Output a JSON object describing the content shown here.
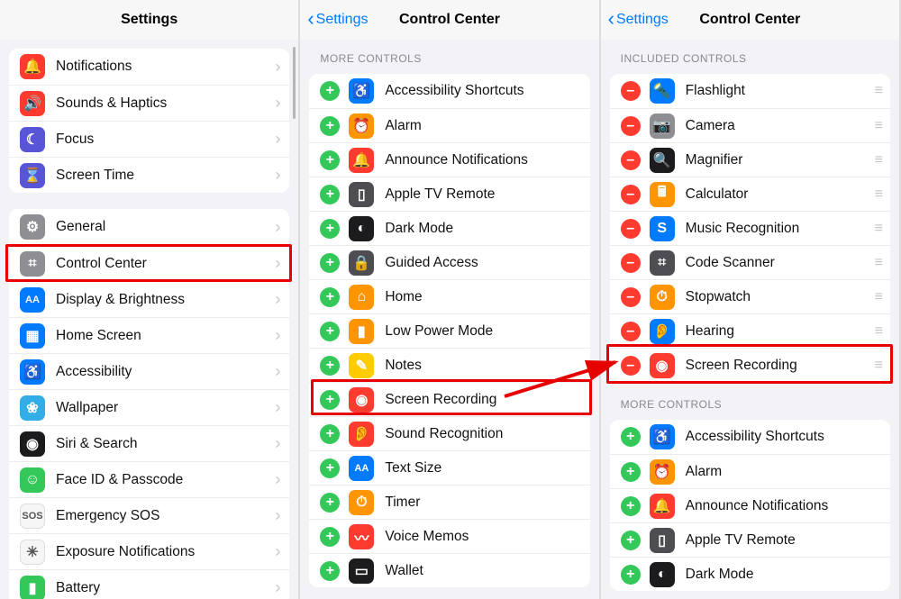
{
  "pane1": {
    "title": "Settings",
    "groupA": [
      {
        "label": "Notifications",
        "icon": "bell",
        "color": "c-red"
      },
      {
        "label": "Sounds & Haptics",
        "icon": "speaker",
        "color": "c-red"
      },
      {
        "label": "Focus",
        "icon": "moon",
        "color": "c-purple"
      },
      {
        "label": "Screen Time",
        "icon": "hourglass",
        "color": "c-purple"
      }
    ],
    "groupB": [
      {
        "label": "General",
        "icon": "gear",
        "color": "c-gray"
      },
      {
        "label": "Control Center",
        "icon": "toggles",
        "color": "c-gray"
      },
      {
        "label": "Display & Brightness",
        "icon": "AA",
        "color": "c-blue"
      },
      {
        "label": "Home Screen",
        "icon": "grid",
        "color": "c-blue"
      },
      {
        "label": "Accessibility",
        "icon": "person",
        "color": "c-blue"
      },
      {
        "label": "Wallpaper",
        "icon": "flower",
        "color": "c-cyan"
      },
      {
        "label": "Siri & Search",
        "icon": "siri",
        "color": "c-black"
      },
      {
        "label": "Face ID & Passcode",
        "icon": "face",
        "color": "c-green"
      },
      {
        "label": "Emergency SOS",
        "icon": "SOS",
        "color": "c-white"
      },
      {
        "label": "Exposure Notifications",
        "icon": "exposure",
        "color": "c-white"
      },
      {
        "label": "Battery",
        "icon": "battery",
        "color": "c-green"
      }
    ]
  },
  "pane2": {
    "back": "Settings",
    "title": "Control Center",
    "header": "More Controls",
    "items": [
      {
        "label": "Accessibility Shortcuts",
        "color": "c-blue",
        "icon": "access"
      },
      {
        "label": "Alarm",
        "color": "c-orange",
        "icon": "clock"
      },
      {
        "label": "Announce Notifications",
        "color": "c-red",
        "icon": "bell"
      },
      {
        "label": "Apple TV Remote",
        "color": "c-darkgray",
        "icon": "remote"
      },
      {
        "label": "Dark Mode",
        "color": "c-black",
        "icon": "dark"
      },
      {
        "label": "Guided Access",
        "color": "c-darkgray",
        "icon": "lock"
      },
      {
        "label": "Home",
        "color": "c-orange",
        "icon": "home"
      },
      {
        "label": "Low Power Mode",
        "color": "c-orange",
        "icon": "battery"
      },
      {
        "label": "Notes",
        "color": "c-yellow",
        "icon": "notes"
      },
      {
        "label": "Screen Recording",
        "color": "c-red",
        "icon": "record"
      },
      {
        "label": "Sound Recognition",
        "color": "c-red",
        "icon": "ear"
      },
      {
        "label": "Text Size",
        "color": "c-blue",
        "icon": "AA"
      },
      {
        "label": "Timer",
        "color": "c-orange",
        "icon": "timer"
      },
      {
        "label": "Voice Memos",
        "color": "c-red",
        "icon": "wave"
      },
      {
        "label": "Wallet",
        "color": "c-black",
        "icon": "wallet"
      }
    ]
  },
  "pane3": {
    "back": "Settings",
    "title": "Control Center",
    "header_included": "Included Controls",
    "included": [
      {
        "label": "Flashlight",
        "color": "c-blue",
        "icon": "torch"
      },
      {
        "label": "Camera",
        "color": "c-gray",
        "icon": "camera"
      },
      {
        "label": "Magnifier",
        "color": "c-black",
        "icon": "magnify"
      },
      {
        "label": "Calculator",
        "color": "c-orange",
        "icon": "calc"
      },
      {
        "label": "Music Recognition",
        "color": "c-blue",
        "icon": "shazam"
      },
      {
        "label": "Code Scanner",
        "color": "c-darkgray",
        "icon": "scan"
      },
      {
        "label": "Stopwatch",
        "color": "c-orange",
        "icon": "stop"
      },
      {
        "label": "Hearing",
        "color": "c-blue",
        "icon": "hearing"
      },
      {
        "label": "Screen Recording",
        "color": "c-red",
        "icon": "record"
      }
    ],
    "header_more": "More Controls",
    "more": [
      {
        "label": "Accessibility Shortcuts",
        "color": "c-blue",
        "icon": "access"
      },
      {
        "label": "Alarm",
        "color": "c-orange",
        "icon": "clock"
      },
      {
        "label": "Announce Notifications",
        "color": "c-red",
        "icon": "bell"
      },
      {
        "label": "Apple TV Remote",
        "color": "c-darkgray",
        "icon": "remote"
      },
      {
        "label": "Dark Mode",
        "color": "c-black",
        "icon": "dark"
      }
    ]
  }
}
